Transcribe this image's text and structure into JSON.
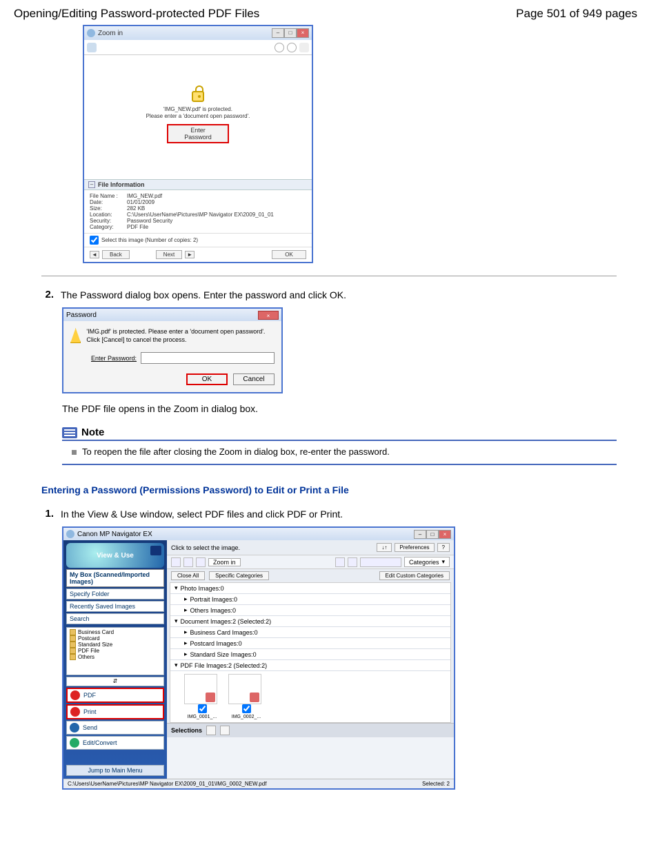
{
  "header": {
    "title": "Opening/Editing Password-protected PDF Files",
    "page_info": "Page 501 of 949 pages"
  },
  "zoom_window": {
    "title": "Zoom in",
    "protected_msg_line1": "'IMG_NEW.pdf' is protected.",
    "protected_msg_line2": "Please enter a 'document open password'.",
    "enter_password_btn": "Enter Password",
    "file_info_header": "File Information",
    "file_name_label": "File Name :",
    "file_name": "IMG_NEW.pdf",
    "date_label": "Date:",
    "date": "01/01/2009",
    "size_label": "Size:",
    "size": "282 KB",
    "location_label": "Location:",
    "location": "C:\\Users\\UserName\\Pictures\\MP Navigator EX\\2009_01_01",
    "security_label": "Security:",
    "security": "Password Security",
    "category_label": "Category:",
    "category": "PDF File",
    "select_checkbox": "Select this image (Number of copies: 2)",
    "back_btn": "Back",
    "next_btn": "Next",
    "ok_btn": "OK"
  },
  "step2": {
    "num": "2.",
    "text": "The Password dialog box opens. Enter the password and click OK."
  },
  "pw_dialog": {
    "title": "Password",
    "msg": "'IMG.pdf' is protected. Please enter a 'document open password'. Click [Cancel] to cancel the process.",
    "label": "Enter Password:",
    "ok": "OK",
    "cancel": "Cancel"
  },
  "after_open": "The PDF file opens in the Zoom in dialog box.",
  "note": {
    "title": "Note",
    "body": "To reopen the file after closing the Zoom in dialog box, re-enter the password."
  },
  "subheading": "Entering a Password (Permissions Password) to Edit or Print a File",
  "step1": {
    "num": "1.",
    "text": "In the View & Use window, select PDF files and click PDF or Print."
  },
  "mp_window": {
    "title": "Canon MP Navigator EX",
    "logo_label": "View & Use",
    "nav_mybox": "My Box (Scanned/Imported Images)",
    "nav_specify": "Specify Folder",
    "nav_recent": "Recently Saved Images",
    "nav_search": "Search",
    "folder_business": "Business Card",
    "folder_postcard": "Postcard",
    "folder_standard": "Standard Size",
    "folder_pdf": "PDF File",
    "folder_others": "Others",
    "action_pdf": "PDF",
    "action_print": "Print",
    "action_send": "Send",
    "action_edit": "Edit/Convert",
    "jump": "Jump to Main Menu",
    "hint": "Click to select the image.",
    "sort_btn": "↓↑",
    "pref_btn": "Preferences",
    "help_btn": "?",
    "zoom_label": "Zoom in",
    "cat_label": "Categories",
    "close_all": "Close All",
    "specific_cat": "Specific Categories",
    "edit_custom": "Edit Custom Categories",
    "cat_photo": "Photo   Images:0",
    "cat_portrait": "Portrait   Images:0",
    "cat_others_img": "Others   Images:0",
    "cat_document": "Document   Images:2   (Selected:2)",
    "cat_bizcard": "Business Card   Images:0",
    "cat_postcard": "Postcard   Images:0",
    "cat_stdsize": "Standard Size   Images:0",
    "cat_pdffile": "PDF File   Images:2   (Selected:2)",
    "thumb1": "IMG_0001_...",
    "thumb2": "IMG_0002_...",
    "selections": "Selections",
    "status_path": "C:\\Users\\UserName\\Pictures\\MP Navigator EX\\2009_01_01\\IMG_0002_NEW.pdf",
    "status_sel": "Selected: 2"
  }
}
